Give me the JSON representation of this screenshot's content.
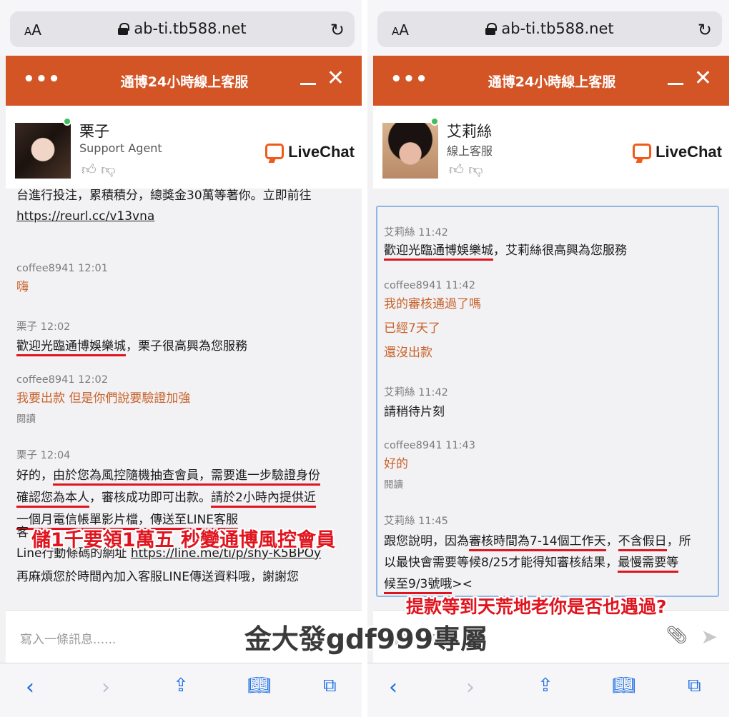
{
  "browser": {
    "text_size_label": "AA",
    "url": "ab-ti.tb588.net",
    "reload_icon": "reload-icon",
    "lock_icon": "lock-icon"
  },
  "chat": {
    "title": "通博24小時線上客服",
    "menu_icon": "more-dots-icon",
    "input_placeholder": "寫入一條訊息......",
    "brand": "LiveChat"
  },
  "left": {
    "agent": {
      "name": "栗子",
      "role": "Support Agent"
    },
    "messages": {
      "m0": {
        "line1": "台進行投注，累積積分，總獎金30萬等著你。立即前往",
        "link": "https://reurl.cc/v13vna"
      },
      "m1": {
        "meta": "coffee8941 12:01",
        "text": "嗨"
      },
      "m2": {
        "meta": "栗子 12:02",
        "text_under": "歡迎光臨通博娛樂城",
        "text_rest": "，栗子很高興為您服務"
      },
      "m3": {
        "meta": "coffee8941 12:02",
        "text": "我要出款 但是你們說要驗證加強",
        "read": "閱讀"
      },
      "m4": {
        "meta": "栗子 12:04",
        "l1a": "好的，",
        "l1b": "由於您為風控隨機抽查會員，需要進一步驗證身份",
        "l2a": "確認您為本人",
        "l2b": "，審核成功即可出款。",
        "l2c": "請於2小時內提供近",
        "l3": "一個月電信帳單影片檔，傳送至LINE客服"
      },
      "m5": {
        "l1": "客",
        "l2a": "Line行動條碼的網址 ",
        "l2link": "https://line.me/ti/p/shy-K5BPOy"
      },
      "m6": {
        "text": "再麻煩您於時間內加入客服LINE傳送資料哦，謝謝您"
      }
    },
    "caption": "儲1千要領1萬五 秒變通博風控會員"
  },
  "right": {
    "agent": {
      "name": "艾莉絲",
      "role": "線上客服"
    },
    "messages": {
      "m1": {
        "meta": "艾莉絲 11:42",
        "text_under": "歡迎光臨通博娛樂城",
        "text_rest": "，艾莉絲很高興為您服務"
      },
      "m2": {
        "meta": "coffee8941 11:42",
        "t1": "我的審核通過了嗎",
        "t2": "已經7天了",
        "t3": "還沒出款"
      },
      "m3": {
        "meta": "艾莉絲 11:42",
        "text": "請稍待片刻"
      },
      "m4": {
        "meta": "coffee8941 11:43",
        "text": "好的",
        "read": "閱讀"
      },
      "m5": {
        "meta": "艾莉絲 11:45",
        "l1a": "跟您說明，因為",
        "l1b": "審核時間為7-14個工作天",
        "l1c": "，",
        "l1d": "不含假日",
        "l1e": "，所",
        "l2a": "以最快會需要等候8/25才能得知審核結果，",
        "l2b": "最慢需要等",
        "l3": "候至9/3號哦",
        "l3b": "><"
      }
    },
    "caption": "提款等到天荒地老你是否也遇過?"
  },
  "toolbar": {
    "back_icon": "back-arrow-icon",
    "forward_icon": "forward-arrow-icon",
    "share_icon": "share-icon",
    "bookmarks_icon": "book-icon",
    "tabs_icon": "tabs-icon"
  },
  "watermark": "金大發gdf999專屬",
  "colors": {
    "header": "#d35424",
    "user_text": "#c8622c",
    "annotation": "#e0141e",
    "toolbar_icon": "#1f6fe5"
  }
}
